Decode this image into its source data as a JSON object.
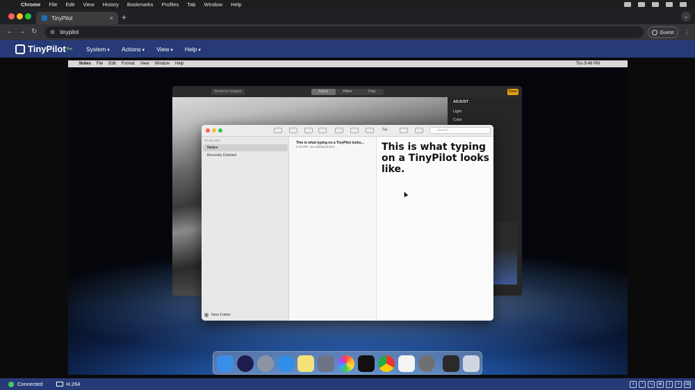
{
  "host_menubar": {
    "app": "Chrome",
    "items": [
      "File",
      "Edit",
      "View",
      "History",
      "Bookmarks",
      "Profiles",
      "Tab",
      "Window",
      "Help"
    ]
  },
  "chrome": {
    "tab_title": "TinyPilot",
    "url": "tinypilot",
    "profile_label": "Guest"
  },
  "tinypilot": {
    "logo_text": "TinyPilot",
    "logo_badge": "Pro",
    "menu": [
      "System",
      "Actions",
      "View",
      "Help"
    ]
  },
  "remote": {
    "menubar": {
      "app": "Notes",
      "items": [
        "File",
        "Edit",
        "Format",
        "View",
        "Window",
        "Help"
      ],
      "time": "Thu 9:46 PM"
    },
    "photos": {
      "revert_label": "Revert to Original",
      "tabs": [
        "Adjust",
        "Filters",
        "Crop"
      ],
      "done_label": "Done",
      "panel_title": "ADJUST",
      "rows": [
        "Light",
        "Color"
      ]
    },
    "notes": {
      "search_placeholder": "Search",
      "format_label": "Aa",
      "sidebar_section": "On My Mac",
      "folders": [
        "Notes",
        "Recently Deleted"
      ],
      "new_folder_label": "New Folder",
      "note_title": "This is what typing on a TinyPilot looks...",
      "note_time": "9:46 PM",
      "note_snippet": "No additional text",
      "note_body": "This is what typing on a TinyPilot looks like."
    },
    "dock_icons": [
      "finder-icon",
      "siri-icon",
      "launchpad-icon",
      "safari-icon",
      "notes-icon",
      "pen-icon",
      "photos-icon",
      "terminal-icon",
      "chrome-icon",
      "reminders-icon",
      "system-preferences-icon",
      "screenshot-icon",
      "trash-icon"
    ]
  },
  "statusbar": {
    "connection": "Connected",
    "codec": "H.264",
    "keys": [
      "⇧",
      "⌃",
      "⌥",
      "⌘",
      "⇪",
      "⏎",
      "⌫"
    ]
  },
  "colors": {
    "tinypilot_blue": "#273a78",
    "connected_green": "#44c767"
  }
}
